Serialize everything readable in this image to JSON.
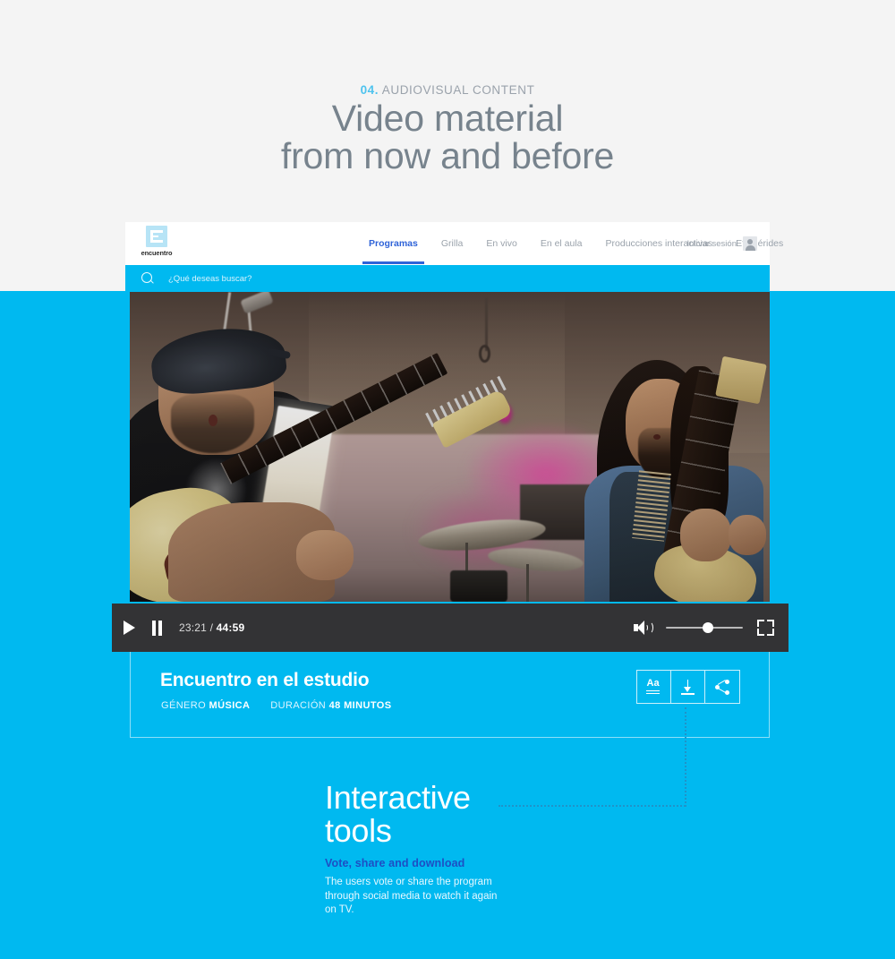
{
  "slide": {
    "eyebrow_number": "04.",
    "eyebrow_text": " AUDIOVISUAL CONTENT",
    "title_line1": "Video material",
    "title_line2": "from now and before",
    "accent_color": "#4ec3ee",
    "background_color": "#f4f4f4",
    "blue_field_color": "#00b9f0"
  },
  "site": {
    "logo_word": "encuentro",
    "nav_items": [
      {
        "label": "Programas",
        "active": true
      },
      {
        "label": "Grilla",
        "active": false
      },
      {
        "label": "En vivo",
        "active": false
      },
      {
        "label": "En el aula",
        "active": false
      },
      {
        "label": "Producciones interactivas",
        "active": false
      },
      {
        "label": "Efemérides",
        "active": false
      }
    ],
    "login_label": "Iniciar sesión",
    "login_icon": "avatar-icon",
    "active_nav_color": "#2f63d8",
    "search": {
      "icon": "search-icon",
      "placeholder": "¿Qué deseas buscar?",
      "value": ""
    }
  },
  "player": {
    "play_icon": "play-icon",
    "pause_icon": "pause-icon",
    "current_time": "23:21",
    "separator": " / ",
    "total_time": "44:59",
    "volume_icon": "volume-icon",
    "volume_percent": 55,
    "fullscreen_icon": "fullscreen-icon",
    "bar_color": "#333335"
  },
  "program": {
    "title": "Encuentro en el estudio",
    "genre_label": "GÉNERO",
    "genre_value": "MÚSICA",
    "duration_label": "DURACIÓN",
    "duration_value": "48 MINUTOS",
    "tools": [
      {
        "name": "text-size-button",
        "icon": "aa-icon",
        "glyph": "Aa"
      },
      {
        "name": "download-button",
        "icon": "download-icon",
        "glyph": ""
      },
      {
        "name": "share-button",
        "icon": "share-icon",
        "glyph": ""
      }
    ]
  },
  "callout": {
    "heading_line1": "Interactive",
    "heading_line2": "tools",
    "subheading": "Vote, share and download",
    "subheading_color": "#1d4fc4",
    "body": "The users vote or share the program through social media to watch it again on TV."
  }
}
